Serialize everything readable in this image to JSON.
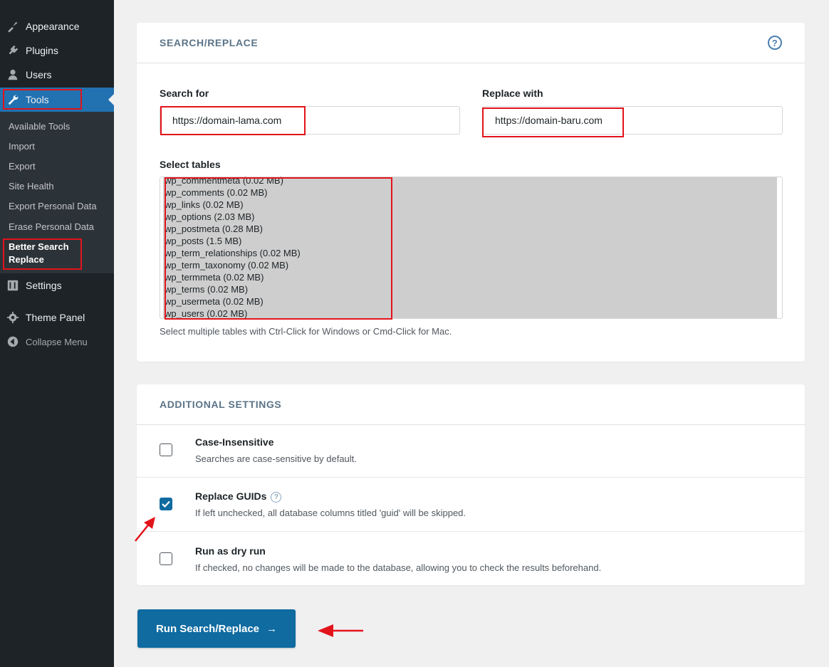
{
  "sidebar": {
    "menu": [
      {
        "label": "Appearance",
        "icon": "paintbrush-icon"
      },
      {
        "label": "Plugins",
        "icon": "plug-icon"
      },
      {
        "label": "Users",
        "icon": "user-icon"
      },
      {
        "label": "Tools",
        "icon": "wrench-icon"
      }
    ],
    "submenu": [
      "Available Tools",
      "Import",
      "Export",
      "Site Health",
      "Export Personal Data",
      "Erase Personal Data",
      "Better Search Replace"
    ],
    "after": [
      {
        "label": "Settings",
        "icon": "sliders-icon"
      },
      {
        "label": "Theme Panel",
        "icon": "gear-icon"
      }
    ],
    "collapse_label": "Collapse Menu"
  },
  "search_replace": {
    "heading": "SEARCH/REPLACE",
    "search_label": "Search for",
    "search_value": "https://domain-lama.com",
    "replace_label": "Replace with",
    "replace_value": "https://domain-baru.com",
    "tables_label": "Select tables",
    "tables": [
      "wp_commentmeta (0.02 MB)",
      "wp_comments (0.02 MB)",
      "wp_links (0.02 MB)",
      "wp_options (2.03 MB)",
      "wp_postmeta (0.28 MB)",
      "wp_posts (1.5 MB)",
      "wp_term_relationships (0.02 MB)",
      "wp_term_taxonomy (0.02 MB)",
      "wp_termmeta (0.02 MB)",
      "wp_terms (0.02 MB)",
      "wp_usermeta (0.02 MB)",
      "wp_users (0.02 MB)"
    ],
    "tables_hint": "Select multiple tables with Ctrl-Click for Windows or Cmd-Click for Mac."
  },
  "additional": {
    "heading": "ADDITIONAL SETTINGS",
    "settings": [
      {
        "title": "Case-Insensitive",
        "desc": "Searches are case-sensitive by default.",
        "checked": false
      },
      {
        "title": "Replace GUIDs",
        "desc": "If left unchecked, all database columns titled 'guid' will be skipped.",
        "checked": true
      },
      {
        "title": "Run as dry run",
        "desc": "If checked, no changes will be made to the database, allowing you to check the results beforehand.",
        "checked": false
      }
    ]
  },
  "run_button": {
    "label": "Run Search/Replace",
    "arrow": "→"
  },
  "colors": {
    "primary": "#0f6ba0",
    "highlight": "#e3131b",
    "sidebar": "#1d2327",
    "active": "#2271b1"
  }
}
